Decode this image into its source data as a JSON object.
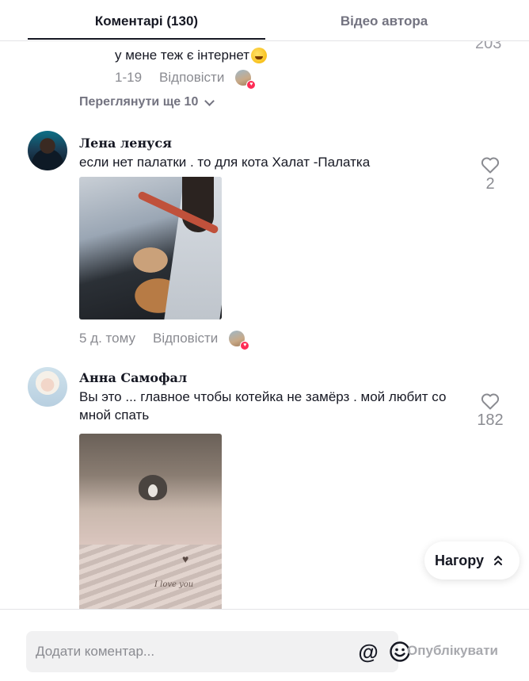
{
  "tabs": {
    "comments": "Коментарі (130)",
    "author_videos": "Відео автора"
  },
  "prev_reply": {
    "text": "у мене теж є інтернет",
    "partial_like_count": "203",
    "date": "1-19",
    "reply_label": "Відповісти",
    "view_more": "Переглянути ще 10"
  },
  "comments": [
    {
      "author": "Лена ленуся",
      "text": "если нет палатки . то для кота Халат -Палатка",
      "likes": "2",
      "date": "5 д. тому",
      "reply_label": "Відповісти"
    },
    {
      "author": "Анна Самофал",
      "text": "Вы это ... главное чтобы котейка не замёрз . мой любит со мной спать",
      "likes": "182",
      "photo_caption": "I love you"
    }
  ],
  "back_to_top": "Нагору",
  "composer": {
    "placeholder": "Додати коментар...",
    "publish": "Опублікувати"
  },
  "colors": {
    "text_primary": "#161823",
    "text_secondary": "#8a8b91",
    "like_badge": "#fe2c55"
  }
}
